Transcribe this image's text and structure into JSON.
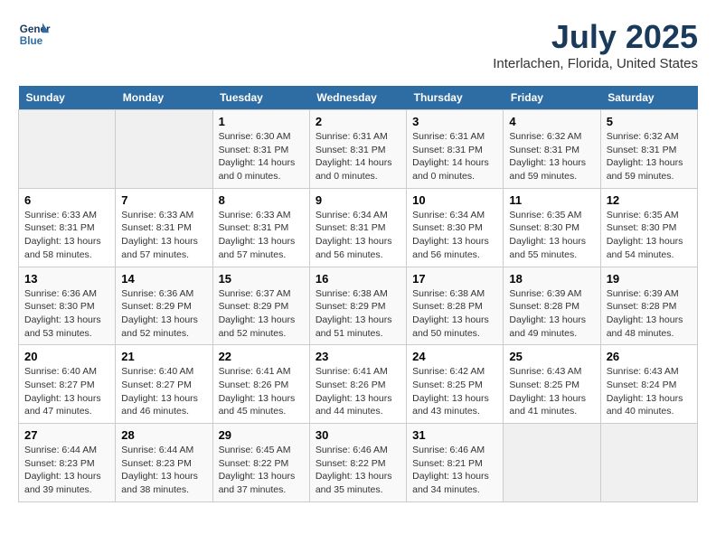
{
  "header": {
    "logo_line1": "General",
    "logo_line2": "Blue",
    "month": "July 2025",
    "location": "Interlachen, Florida, United States"
  },
  "weekdays": [
    "Sunday",
    "Monday",
    "Tuesday",
    "Wednesday",
    "Thursday",
    "Friday",
    "Saturday"
  ],
  "weeks": [
    [
      {
        "day": "",
        "sunrise": "",
        "sunset": "",
        "daylight": ""
      },
      {
        "day": "",
        "sunrise": "",
        "sunset": "",
        "daylight": ""
      },
      {
        "day": "1",
        "sunrise": "Sunrise: 6:30 AM",
        "sunset": "Sunset: 8:31 PM",
        "daylight": "Daylight: 14 hours and 0 minutes."
      },
      {
        "day": "2",
        "sunrise": "Sunrise: 6:31 AM",
        "sunset": "Sunset: 8:31 PM",
        "daylight": "Daylight: 14 hours and 0 minutes."
      },
      {
        "day": "3",
        "sunrise": "Sunrise: 6:31 AM",
        "sunset": "Sunset: 8:31 PM",
        "daylight": "Daylight: 14 hours and 0 minutes."
      },
      {
        "day": "4",
        "sunrise": "Sunrise: 6:32 AM",
        "sunset": "Sunset: 8:31 PM",
        "daylight": "Daylight: 13 hours and 59 minutes."
      },
      {
        "day": "5",
        "sunrise": "Sunrise: 6:32 AM",
        "sunset": "Sunset: 8:31 PM",
        "daylight": "Daylight: 13 hours and 59 minutes."
      }
    ],
    [
      {
        "day": "6",
        "sunrise": "Sunrise: 6:33 AM",
        "sunset": "Sunset: 8:31 PM",
        "daylight": "Daylight: 13 hours and 58 minutes."
      },
      {
        "day": "7",
        "sunrise": "Sunrise: 6:33 AM",
        "sunset": "Sunset: 8:31 PM",
        "daylight": "Daylight: 13 hours and 57 minutes."
      },
      {
        "day": "8",
        "sunrise": "Sunrise: 6:33 AM",
        "sunset": "Sunset: 8:31 PM",
        "daylight": "Daylight: 13 hours and 57 minutes."
      },
      {
        "day": "9",
        "sunrise": "Sunrise: 6:34 AM",
        "sunset": "Sunset: 8:31 PM",
        "daylight": "Daylight: 13 hours and 56 minutes."
      },
      {
        "day": "10",
        "sunrise": "Sunrise: 6:34 AM",
        "sunset": "Sunset: 8:30 PM",
        "daylight": "Daylight: 13 hours and 56 minutes."
      },
      {
        "day": "11",
        "sunrise": "Sunrise: 6:35 AM",
        "sunset": "Sunset: 8:30 PM",
        "daylight": "Daylight: 13 hours and 55 minutes."
      },
      {
        "day": "12",
        "sunrise": "Sunrise: 6:35 AM",
        "sunset": "Sunset: 8:30 PM",
        "daylight": "Daylight: 13 hours and 54 minutes."
      }
    ],
    [
      {
        "day": "13",
        "sunrise": "Sunrise: 6:36 AM",
        "sunset": "Sunset: 8:30 PM",
        "daylight": "Daylight: 13 hours and 53 minutes."
      },
      {
        "day": "14",
        "sunrise": "Sunrise: 6:36 AM",
        "sunset": "Sunset: 8:29 PM",
        "daylight": "Daylight: 13 hours and 52 minutes."
      },
      {
        "day": "15",
        "sunrise": "Sunrise: 6:37 AM",
        "sunset": "Sunset: 8:29 PM",
        "daylight": "Daylight: 13 hours and 52 minutes."
      },
      {
        "day": "16",
        "sunrise": "Sunrise: 6:38 AM",
        "sunset": "Sunset: 8:29 PM",
        "daylight": "Daylight: 13 hours and 51 minutes."
      },
      {
        "day": "17",
        "sunrise": "Sunrise: 6:38 AM",
        "sunset": "Sunset: 8:28 PM",
        "daylight": "Daylight: 13 hours and 50 minutes."
      },
      {
        "day": "18",
        "sunrise": "Sunrise: 6:39 AM",
        "sunset": "Sunset: 8:28 PM",
        "daylight": "Daylight: 13 hours and 49 minutes."
      },
      {
        "day": "19",
        "sunrise": "Sunrise: 6:39 AM",
        "sunset": "Sunset: 8:28 PM",
        "daylight": "Daylight: 13 hours and 48 minutes."
      }
    ],
    [
      {
        "day": "20",
        "sunrise": "Sunrise: 6:40 AM",
        "sunset": "Sunset: 8:27 PM",
        "daylight": "Daylight: 13 hours and 47 minutes."
      },
      {
        "day": "21",
        "sunrise": "Sunrise: 6:40 AM",
        "sunset": "Sunset: 8:27 PM",
        "daylight": "Daylight: 13 hours and 46 minutes."
      },
      {
        "day": "22",
        "sunrise": "Sunrise: 6:41 AM",
        "sunset": "Sunset: 8:26 PM",
        "daylight": "Daylight: 13 hours and 45 minutes."
      },
      {
        "day": "23",
        "sunrise": "Sunrise: 6:41 AM",
        "sunset": "Sunset: 8:26 PM",
        "daylight": "Daylight: 13 hours and 44 minutes."
      },
      {
        "day": "24",
        "sunrise": "Sunrise: 6:42 AM",
        "sunset": "Sunset: 8:25 PM",
        "daylight": "Daylight: 13 hours and 43 minutes."
      },
      {
        "day": "25",
        "sunrise": "Sunrise: 6:43 AM",
        "sunset": "Sunset: 8:25 PM",
        "daylight": "Daylight: 13 hours and 41 minutes."
      },
      {
        "day": "26",
        "sunrise": "Sunrise: 6:43 AM",
        "sunset": "Sunset: 8:24 PM",
        "daylight": "Daylight: 13 hours and 40 minutes."
      }
    ],
    [
      {
        "day": "27",
        "sunrise": "Sunrise: 6:44 AM",
        "sunset": "Sunset: 8:23 PM",
        "daylight": "Daylight: 13 hours and 39 minutes."
      },
      {
        "day": "28",
        "sunrise": "Sunrise: 6:44 AM",
        "sunset": "Sunset: 8:23 PM",
        "daylight": "Daylight: 13 hours and 38 minutes."
      },
      {
        "day": "29",
        "sunrise": "Sunrise: 6:45 AM",
        "sunset": "Sunset: 8:22 PM",
        "daylight": "Daylight: 13 hours and 37 minutes."
      },
      {
        "day": "30",
        "sunrise": "Sunrise: 6:46 AM",
        "sunset": "Sunset: 8:22 PM",
        "daylight": "Daylight: 13 hours and 35 minutes."
      },
      {
        "day": "31",
        "sunrise": "Sunrise: 6:46 AM",
        "sunset": "Sunset: 8:21 PM",
        "daylight": "Daylight: 13 hours and 34 minutes."
      },
      {
        "day": "",
        "sunrise": "",
        "sunset": "",
        "daylight": ""
      },
      {
        "day": "",
        "sunrise": "",
        "sunset": "",
        "daylight": ""
      }
    ]
  ]
}
